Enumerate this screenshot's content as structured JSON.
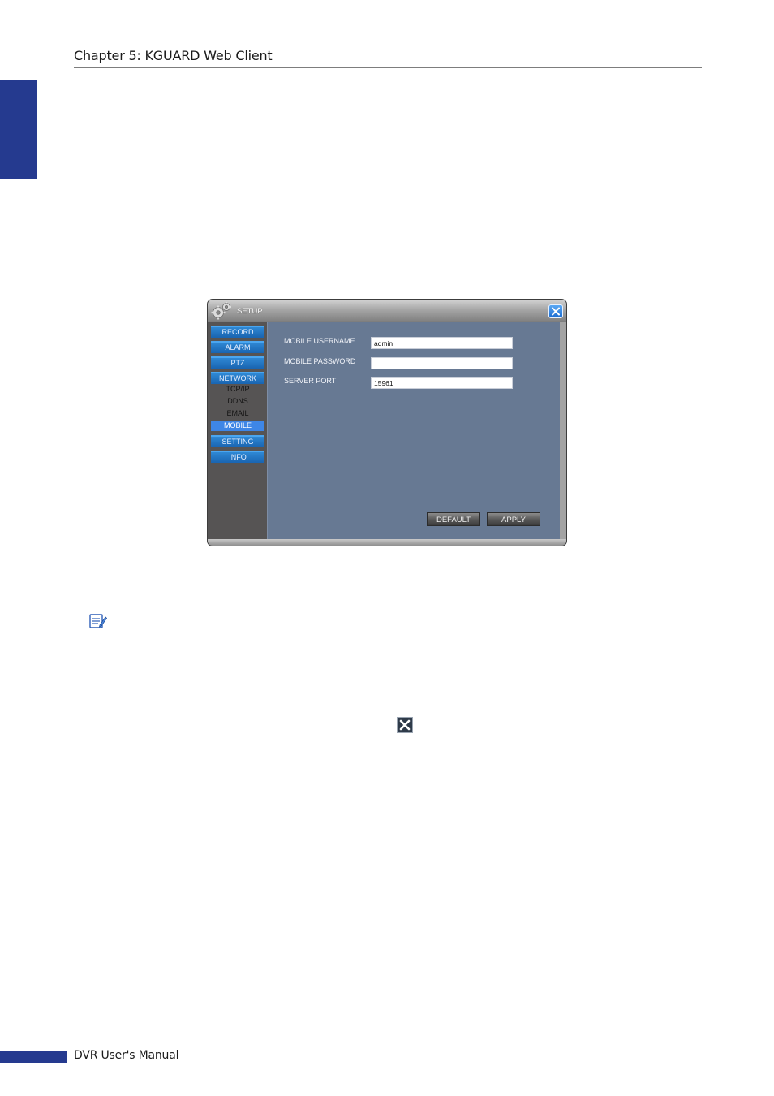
{
  "header": {
    "chapter_title": "Chapter 5: KGUARD Web Client"
  },
  "setup_window": {
    "title": "SETUP",
    "nav": {
      "record": "RECORD",
      "alarm": "ALARM",
      "ptz": "PTZ",
      "network": "NETWORK",
      "tcpip": "TCP/IP",
      "ddns": "DDNS",
      "email": "EMAIL",
      "mobile": "MOBILE",
      "setting": "SETTING",
      "info": "INFO"
    },
    "active_item": "MOBILE",
    "fields": {
      "mobile_username_label": "MOBILE USERNAME",
      "mobile_username_value": "admin",
      "mobile_password_label": "MOBILE PASSWORD",
      "mobile_password_value": "",
      "server_port_label": "SERVER PORT",
      "server_port_value": "15961"
    },
    "buttons": {
      "default": "DEFAULT",
      "apply": "APPLY"
    }
  },
  "icons": {
    "gear": "gear-icon",
    "close": "close-icon",
    "note": "note-icon",
    "x": "x-close-icon"
  },
  "footer": {
    "title": "DVR User's Manual"
  },
  "colors": {
    "brand_blue": "#253a8f",
    "nav_blue": "#1f72c2",
    "active_blue": "#3e86e6",
    "content_bg": "#677993"
  }
}
